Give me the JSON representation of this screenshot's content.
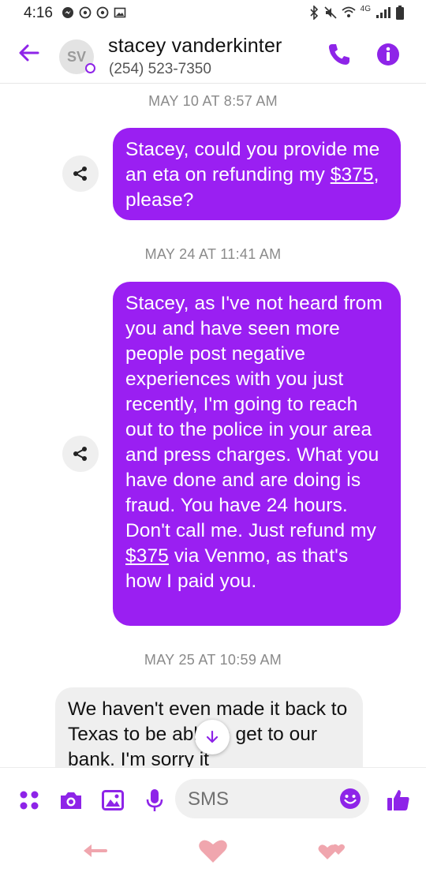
{
  "status_bar": {
    "time": "4:16",
    "network": "4G"
  },
  "header": {
    "avatar_initials": "SV",
    "contact_name": "stacey vanderkinter",
    "contact_phone": "(254) 523-7350",
    "icons": [
      "back-arrow-icon",
      "phone-icon",
      "info-icon"
    ]
  },
  "conversation": {
    "messages": [
      {
        "date": "MAY 10 AT 8:57 AM",
        "direction": "outgoing",
        "text_before": "Stacey, could you provide me an eta on refunding my ",
        "link": "$375",
        "text_after": ", please?"
      },
      {
        "date": "MAY 24 AT 11:41 AM",
        "direction": "outgoing",
        "text_before": "Stacey, as I've not heard from you and have seen more people post negative experiences with you just recently, I'm going to reach out to the police in your area and press charges. What you have done and are doing is fraud. You have 24 hours. Don't call me. Just refund my ",
        "link": "$375",
        "text_after": " via Venmo, as that's how I paid you."
      },
      {
        "date": "MAY 25 AT 10:59 AM",
        "direction": "incoming",
        "text": "We haven't even made it back to Texas to be able to get to our bank. I'm sorry it"
      }
    ]
  },
  "composer": {
    "placeholder": "SMS",
    "icons": [
      "apps-icon",
      "camera-icon",
      "gallery-icon",
      "microphone-icon",
      "emoji-icon",
      "thumbs-up-icon"
    ]
  },
  "colors": {
    "accent": "#8e24e8",
    "bubble_outgoing": "#9a1ff2",
    "bubble_incoming": "#efefef"
  }
}
